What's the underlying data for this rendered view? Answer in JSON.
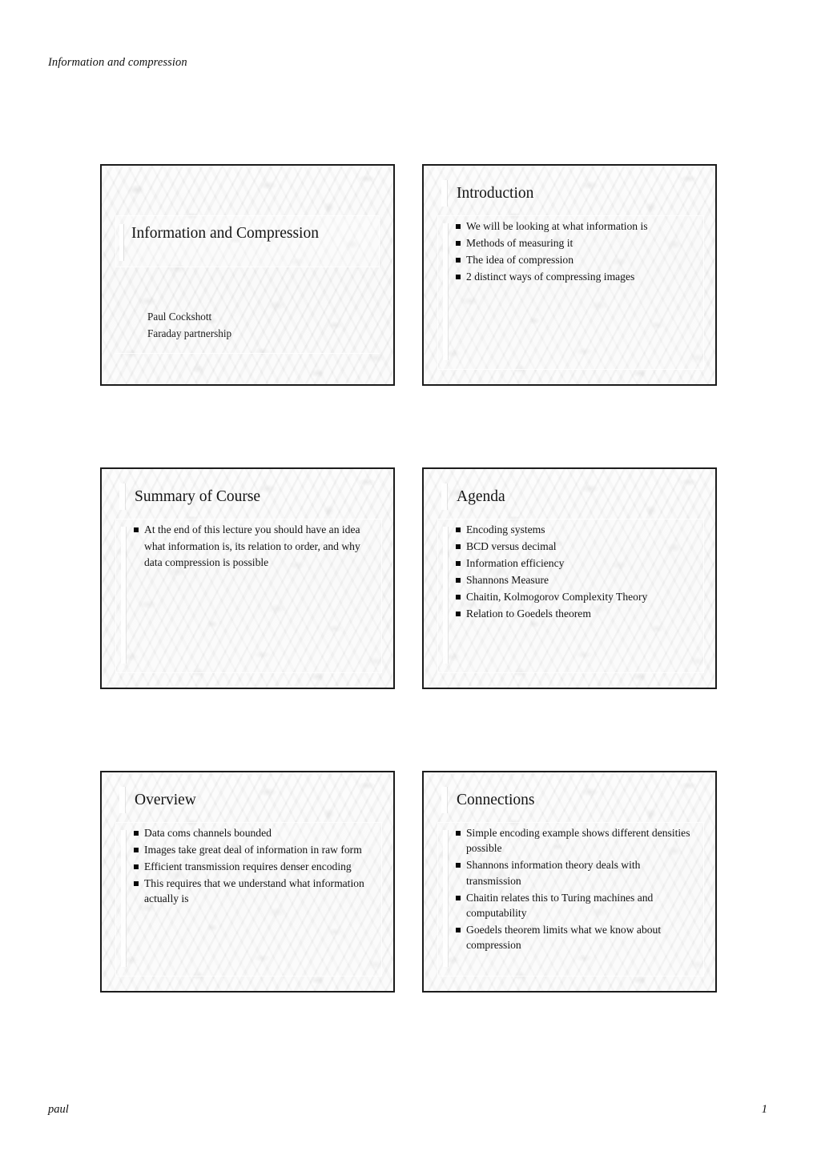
{
  "page": {
    "running_head": "Information and compression",
    "footer_left": "paul",
    "footer_page_number": "1"
  },
  "slides": [
    {
      "id": "title-slide",
      "layout": "title",
      "title": "Information and Compression",
      "subtitle_lines": [
        "Paul Cockshott",
        "Faraday partnership"
      ]
    },
    {
      "id": "introduction",
      "layout": "content",
      "title": "Introduction",
      "bullets": [
        "We will be looking at what information is",
        "Methods of measuring it",
        "The idea of compression",
        "2 distinct ways of compressing images"
      ]
    },
    {
      "id": "summary-of-course",
      "layout": "content",
      "title": "Summary of Course",
      "bullets": [
        "At the end of this lecture you should have an idea what information is, its relation to order, and why data compression is possible"
      ]
    },
    {
      "id": "agenda",
      "layout": "content",
      "title": "Agenda",
      "bullets": [
        "Encoding systems",
        "BCD versus decimal",
        "Information efficiency",
        "Shannons Measure",
        "Chaitin, Kolmogorov Complexity Theory",
        "Relation to Goedels theorem"
      ]
    },
    {
      "id": "overview",
      "layout": "content",
      "title": "Overview",
      "bullets": [
        "Data coms channels bounded",
        "Images take great deal of information in raw form",
        "Efficient transmission requires denser encoding",
        "This requires that we understand what information actually is"
      ]
    },
    {
      "id": "connections",
      "layout": "content",
      "title": "Connections",
      "bullets": [
        "Simple encoding example shows different densities possible",
        "Shannons information theory deals with transmission",
        "Chaitin relates this to Turing machines and computability",
        "Goedels theorem limits what we know about compression"
      ]
    }
  ],
  "style": {
    "slide_border_color": "#1c1c1c",
    "text_color": "#131313",
    "bullet_color": "#090909",
    "page_background": "#ffffff"
  }
}
